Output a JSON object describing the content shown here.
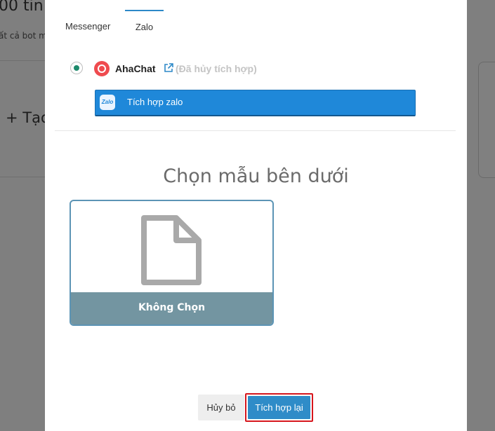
{
  "background": {
    "title": "00 tin t",
    "subtitle": "ất cả bot m",
    "create_label": "+ Tạo"
  },
  "tabs": [
    {
      "label": "Messenger",
      "active": false
    },
    {
      "label": "Zalo",
      "active": true
    }
  ],
  "account": {
    "name": "AhaChat",
    "status": "(Đã hủy tích hợp)",
    "selected": true,
    "logo_icon": "ahachat-logo-icon",
    "external_icon": "external-link-icon"
  },
  "integrate_zalo": {
    "icon_text": "Zalo",
    "label": "Tích hợp zalo"
  },
  "templates": {
    "heading": "Chọn mẫu bên dưới",
    "items": [
      {
        "label": "Không Chọn",
        "icon": "blank-document-icon"
      }
    ]
  },
  "footer": {
    "cancel_label": "Hủy bỏ",
    "submit_label": "Tích hợp lại"
  },
  "colors": {
    "primary": "#2f8cc8",
    "zalo_blue": "#1f88d9",
    "template_footer": "#7395a1",
    "highlight_border": "#d6161d",
    "radio_dot": "#1e8a6c",
    "brand_red": "#ef4b4f"
  }
}
